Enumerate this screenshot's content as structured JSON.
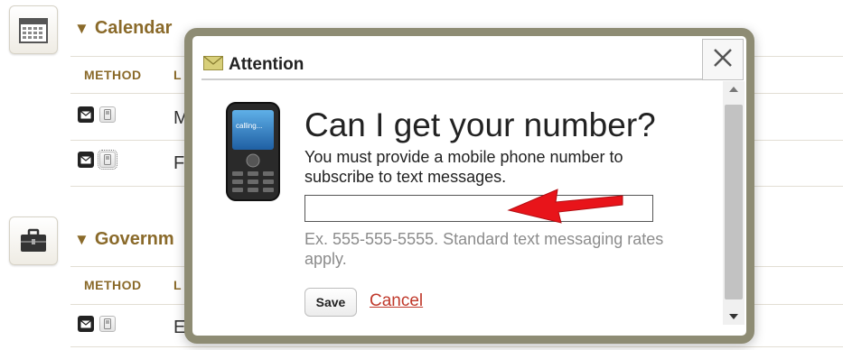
{
  "sections": [
    {
      "id": "calendar",
      "title": "Calendar",
      "icon": "calendar-icon"
    },
    {
      "id": "government",
      "title": "Governm",
      "icon": "briefcase-icon"
    }
  ],
  "table": {
    "method_header": "METHOD",
    "list_header_fragment": "L",
    "rows": [
      {
        "text": "M"
      },
      {
        "text": "F"
      },
      {
        "text": "E"
      }
    ]
  },
  "modal": {
    "title": "Attention",
    "heading": "Can I get your number?",
    "description": "You must provide a mobile phone number to subscribe to text messages.",
    "input_value": "",
    "hint": "Ex. 555-555-5555. Standard text messaging rates apply.",
    "save_label": "Save",
    "cancel_label": "Cancel",
    "close_glyph": "✕",
    "phone_screen_text": "calling..."
  },
  "colors": {
    "accent": "#8a6a2a",
    "frame": "#8e8c74",
    "link": "#c0392b",
    "arrow": "#e8141a"
  }
}
